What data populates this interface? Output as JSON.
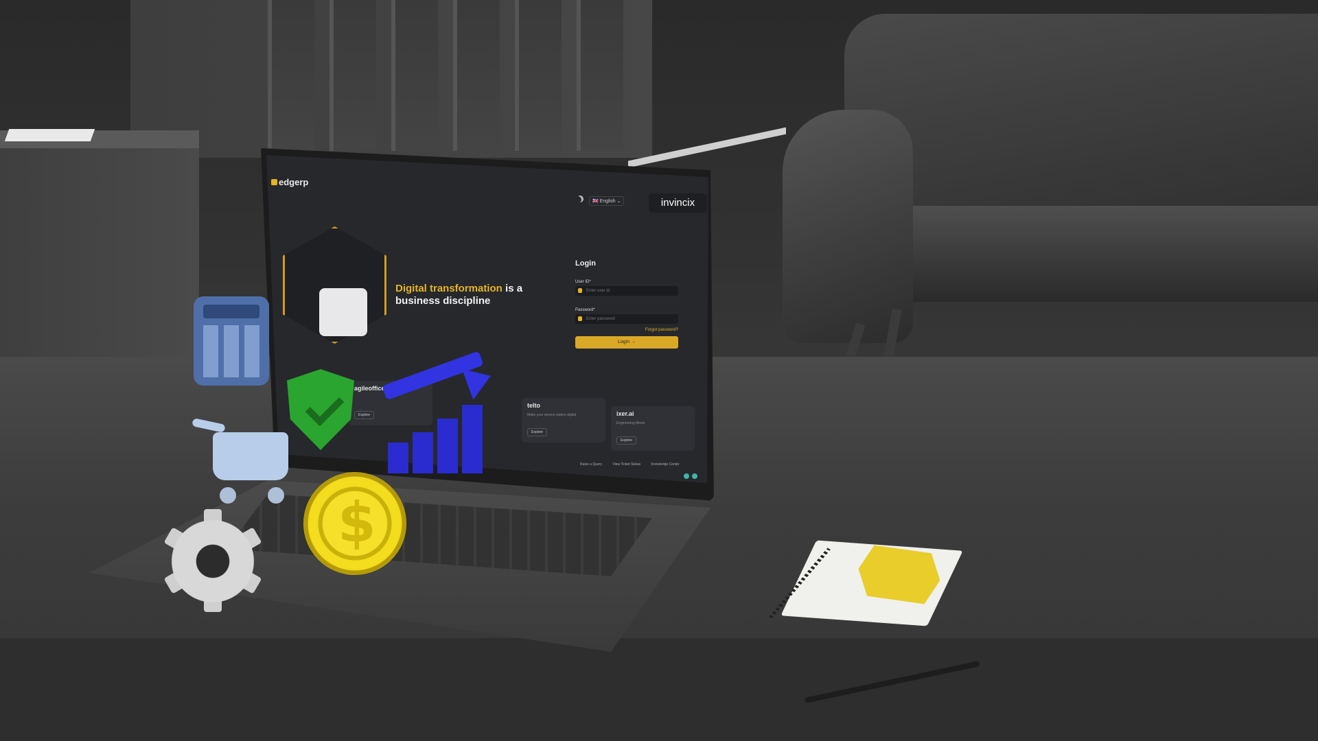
{
  "screen": {
    "logo": "edgerp",
    "brand": "invincix",
    "language": "English",
    "headline_highlight": "Digital transformation",
    "headline_rest": "is a business discipline",
    "login": {
      "title": "Login",
      "user_label": "User ID*",
      "user_placeholder": "Enter user id",
      "password_label": "Password*",
      "password_placeholder": "Enter password",
      "forgot": "Forgot password?",
      "button": "Login →"
    },
    "products": [
      {
        "name": "agileoffice",
        "desc": "",
        "cta": "Explore"
      },
      {
        "name": "telto",
        "desc": "Make your service station digital",
        "cta": "Explore"
      },
      {
        "name": "ixer.ai",
        "desc": "Engineering Minds",
        "cta": "Explore"
      }
    ],
    "footer_links": [
      "Raise a Query",
      "View Ticket Status",
      "Knowledge Center"
    ]
  },
  "colors": {
    "accent": "#e5b325",
    "screen_bg": "#26282c",
    "card_bg": "#2f3136"
  },
  "icons": [
    "calculator-icon",
    "shield-check-icon",
    "growth-chart-icon",
    "shopping-cart-icon",
    "dollar-coin-icon",
    "gear-icon"
  ]
}
